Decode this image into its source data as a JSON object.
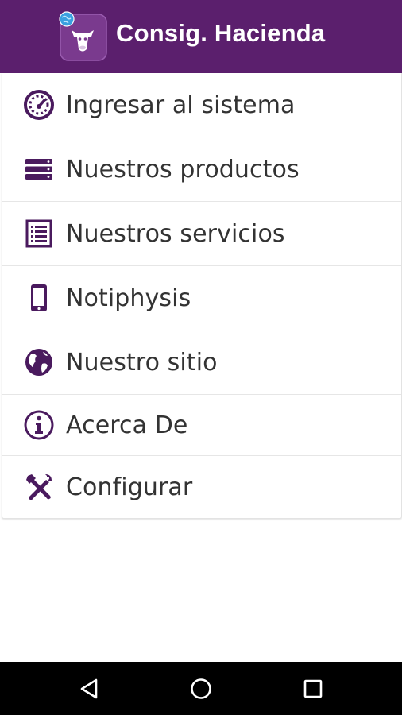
{
  "app": {
    "title": "Consig. Hacienda",
    "logo_icon": "cow-globe-logo-icon"
  },
  "colors": {
    "appbar": "#5b1f6d",
    "icon": "#4a1a5e",
    "text": "#333333",
    "navbar": "#000000"
  },
  "menu": {
    "items": [
      {
        "label": "Ingresar al sistema",
        "icon": "dashboard-gauge-icon"
      },
      {
        "label": "Nuestros productos",
        "icon": "server-stack-icon"
      },
      {
        "label": "Nuestros servicios",
        "icon": "list-document-icon"
      },
      {
        "label": "Notiphysis",
        "icon": "smartphone-icon"
      },
      {
        "label": "Nuestro sitio",
        "icon": "globe-icon"
      },
      {
        "label": "Acerca De",
        "icon": "info-icon"
      },
      {
        "label": "Configurar",
        "icon": "tools-icon"
      }
    ]
  },
  "navbar": {
    "buttons": [
      "back-icon",
      "home-icon",
      "recents-icon"
    ]
  }
}
